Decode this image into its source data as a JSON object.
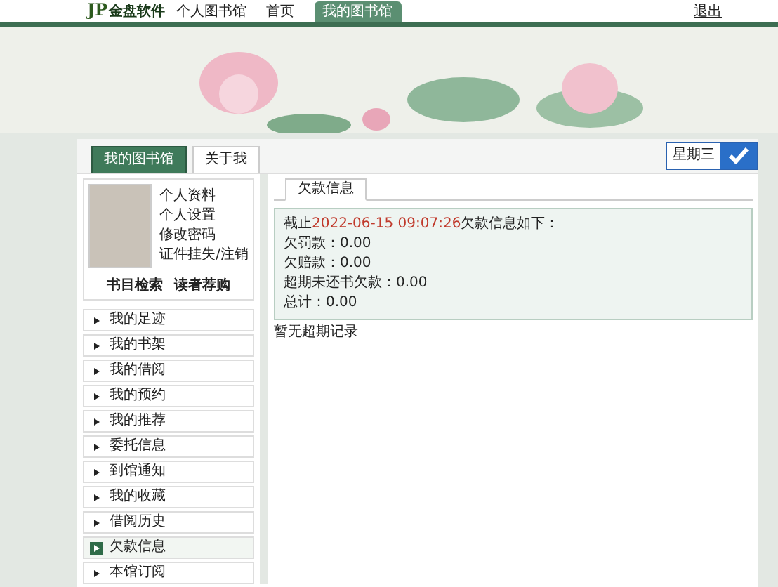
{
  "topbar": {
    "logo_mark": "JP",
    "logo_text": "金盘软件",
    "site_title": "个人图书馆",
    "nav": [
      {
        "label": "首页",
        "selected": false
      },
      {
        "label": "我的图书馆",
        "selected": true
      }
    ],
    "logout": "退出"
  },
  "tabs": [
    {
      "label": "我的图书馆",
      "selected": true
    },
    {
      "label": "关于我",
      "selected": false
    }
  ],
  "calendar": {
    "weekday": "星期三"
  },
  "profile": {
    "links": [
      "个人资料",
      "个人设置",
      "修改密码",
      "证件挂失/注销"
    ],
    "actions": [
      "书目检索",
      "读者荐购"
    ]
  },
  "menu": [
    {
      "label": "我的足迹",
      "selected": false
    },
    {
      "label": "我的书架",
      "selected": false
    },
    {
      "label": "我的借阅",
      "selected": false
    },
    {
      "label": "我的预约",
      "selected": false
    },
    {
      "label": "我的推荐",
      "selected": false
    },
    {
      "label": "委托信息",
      "selected": false
    },
    {
      "label": "到馆通知",
      "selected": false
    },
    {
      "label": "我的收藏",
      "selected": false
    },
    {
      "label": "借阅历史",
      "selected": false
    },
    {
      "label": "欠款信息",
      "selected": true
    },
    {
      "label": "本馆订阅",
      "selected": false
    }
  ],
  "content": {
    "tab": "欠款信息",
    "summary": {
      "prefix": "截止",
      "date": "2022-06-15 09:07:26",
      "suffix": "欠款信息如下："
    },
    "lines": [
      "欠罚款：0.00",
      "欠赔款：0.00",
      "超期未还书欠款：0.00",
      "总计：0.00"
    ],
    "note": "暂无超期记录"
  }
}
